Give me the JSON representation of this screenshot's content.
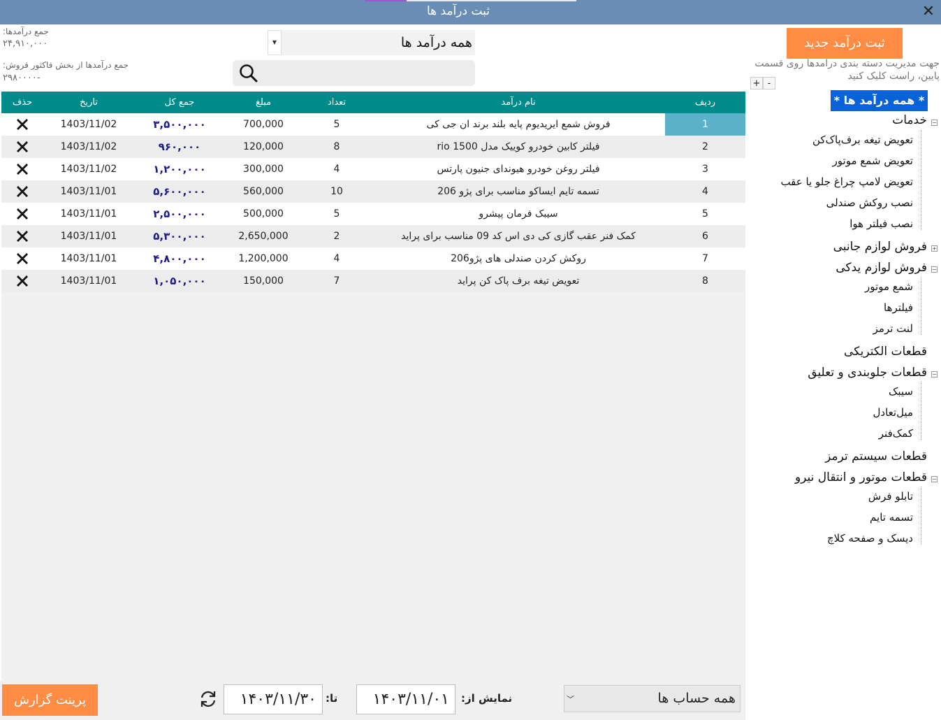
{
  "window": {
    "title": "ثبت درآمد ها"
  },
  "summary": {
    "total_label": "جمع درآمدها:",
    "total_value": "۲۴,۹۱۰,۰۰۰",
    "invoice_label": "جمع درآمدها از بخش فاکتور فروش:",
    "invoice_value": "۲۹۸۰۰۰۰-"
  },
  "filter": {
    "category_selected": "همه درآمد ها",
    "search_placeholder": ""
  },
  "table": {
    "headers": {
      "radif": "ردیف",
      "name": "نام درآمد",
      "qty": "تعداد",
      "amount": "مبلغ",
      "total": "جمع کل",
      "date": "تاریخ",
      "delete": "حذف"
    },
    "rows": [
      {
        "radif": "1",
        "name": "فروش شمع ایریدیوم پایه بلند برند ان جی کی",
        "qty": "5",
        "amount": "700,000",
        "total": "۳,۵۰۰,۰۰۰",
        "date": "1403/11/02"
      },
      {
        "radif": "2",
        "name": "فیلتر کابین خودرو کوییک مدل rio 1500",
        "qty": "8",
        "amount": "120,000",
        "total": "۹۶۰,۰۰۰",
        "date": "1403/11/02"
      },
      {
        "radif": "3",
        "name": "فیلتر روغن خودرو هیوندای جنیون پارتس",
        "qty": "4",
        "amount": "300,000",
        "total": "۱,۲۰۰,۰۰۰",
        "date": "1403/11/02"
      },
      {
        "radif": "4",
        "name": "تسمه تایم ایساکو مناسب برای پژو 206",
        "qty": "10",
        "amount": "560,000",
        "total": "۵,۶۰۰,۰۰۰",
        "date": "1403/11/01"
      },
      {
        "radif": "5",
        "name": "سیبک فرمان پیشرو",
        "qty": "5",
        "amount": "500,000",
        "total": "۲,۵۰۰,۰۰۰",
        "date": "1403/11/01"
      },
      {
        "radif": "6",
        "name": "کمک فنر عقب گازی کی دی اس کد 09 مناسب برای پراید",
        "qty": "2",
        "amount": "2,650,000",
        "total": "۵,۳۰۰,۰۰۰",
        "date": "1403/11/01"
      },
      {
        "radif": "7",
        "name": "روکش کردن صندلی های پژو206",
        "qty": "4",
        "amount": "1,200,000",
        "total": "۴,۸۰۰,۰۰۰",
        "date": "1403/11/01"
      },
      {
        "radif": "8",
        "name": "تعویض تیغه برف پاک کن پراید",
        "qty": "7",
        "amount": "150,000",
        "total": "۱,۰۵۰,۰۰۰",
        "date": "1403/11/01"
      }
    ]
  },
  "sidebar": {
    "new_button": "ثبت درآمد جدید",
    "hint": "جهت مدیریت دسته بندی درامدها روی قسمت پایین، راست کلیک کنید",
    "plus": "+",
    "minus": "-",
    "tree_root": "* همه درآمد ها *",
    "tree": [
      {
        "label": "خدمات",
        "children": [
          "تعویض تیغه برف‌پاک‌کن",
          "تعویض شمع موتور",
          "تعویض لامپ چراغ جلو یا عقب",
          "نصب روکش صندلی",
          "نصب فیلتر هوا"
        ]
      },
      {
        "label": "فروش لوازم جانبی",
        "children": []
      },
      {
        "label": "فروش لوازم یدکی",
        "children": [
          "شمع موتور",
          "فیلترها",
          "لنت ترمز"
        ]
      },
      {
        "label": "قطعات الکتریکی",
        "children": []
      },
      {
        "label": "قطعات جلوبندی و تعلیق",
        "children": [
          "سیبک",
          "میل‌تعادل",
          "کمک‌فنر"
        ]
      },
      {
        "label": "قطعات سیستم ترمز",
        "children": []
      },
      {
        "label": "قطعات موتور و انتقال نیرو",
        "children": [
          "تابلو فرش",
          "تسمه تایم",
          "دیسک و صفحه کلاچ"
        ]
      }
    ]
  },
  "footer": {
    "print_button": "پرینت گزارش",
    "to_label": "تا:",
    "to_date": "۱۴۰۳/۱۱/۳۰",
    "from_label": "نمایش از:",
    "from_date": "۱۴۰۳/۱۱/۰۱",
    "accounts_selected": "همه حساب ها"
  },
  "colors": {
    "accent_orange": "#ff8c42",
    "header_teal": "#008b8b",
    "tree_selection": "#0a62d8",
    "total_text": "#1a1a8a",
    "titlebar": "#6a8db5"
  }
}
